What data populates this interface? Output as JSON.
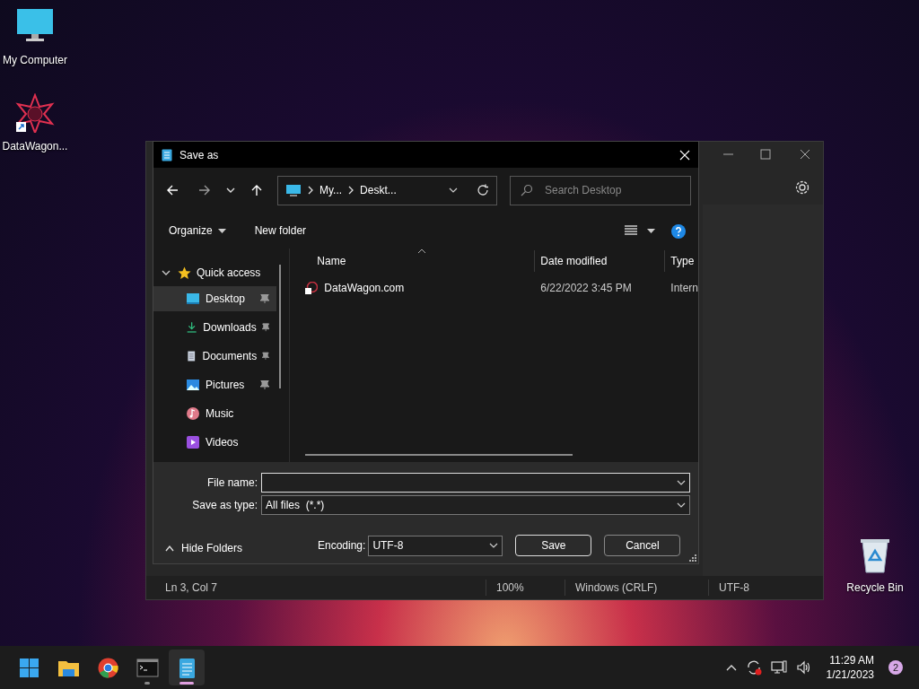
{
  "desktop_icons": [
    {
      "kind": "computer",
      "label": "My Computer"
    },
    {
      "kind": "shortcut",
      "label": "DataWagon..."
    },
    {
      "kind": "recycle",
      "label": "Recycle Bin"
    }
  ],
  "notepad": {
    "status_bar": [
      "Ln 3, Col 7",
      "100%",
      "Windows (CRLF)",
      "UTF-8"
    ]
  },
  "dialog": {
    "title": "Save as",
    "address": {
      "crumbs": [
        "My...",
        "Deskt..."
      ]
    },
    "search": {
      "placeholder": "Search Desktop"
    },
    "commands": {
      "organize": "Organize",
      "new_folder": "New folder"
    },
    "nav": {
      "label": "Quick access",
      "expanded": true,
      "children": [
        {
          "kind": "desktop",
          "label": "Desktop",
          "pinned": true,
          "selected": true
        },
        {
          "kind": "downloads",
          "label": "Downloads",
          "pinned": true,
          "selected": false
        },
        {
          "kind": "documents",
          "label": "Documents",
          "pinned": true,
          "selected": false
        },
        {
          "kind": "pictures",
          "label": "Pictures",
          "pinned": true,
          "selected": false
        },
        {
          "kind": "music",
          "label": "Music",
          "pinned": false,
          "selected": false
        },
        {
          "kind": "videos",
          "label": "Videos",
          "pinned": false,
          "selected": false
        }
      ]
    },
    "columns": [
      "Name",
      "Date modified",
      "Type"
    ],
    "files": [
      {
        "name": "DataWagon.com",
        "date": "6/22/2022 3:45 PM",
        "type": "Intern"
      }
    ],
    "file_name": {
      "label": "File name:"
    },
    "save_as_type": {
      "label": "Save as type:",
      "value": "All files  (*.*)"
    },
    "hide_folders": "Hide Folders",
    "encoding": {
      "label": "Encoding:",
      "value": "UTF-8"
    },
    "buttons": [
      "Save",
      "Cancel"
    ]
  },
  "taskbar": {
    "apps": [
      {
        "kind": "start",
        "running": false,
        "active": false
      },
      {
        "kind": "explorer",
        "running": false,
        "active": false
      },
      {
        "kind": "chrome",
        "running": false,
        "active": false
      },
      {
        "kind": "terminal",
        "running": true,
        "active": false
      },
      {
        "kind": "notepad",
        "running": true,
        "active": true
      }
    ],
    "time": "11:29 AM",
    "date": "1/21/2023",
    "notifications": "2"
  }
}
